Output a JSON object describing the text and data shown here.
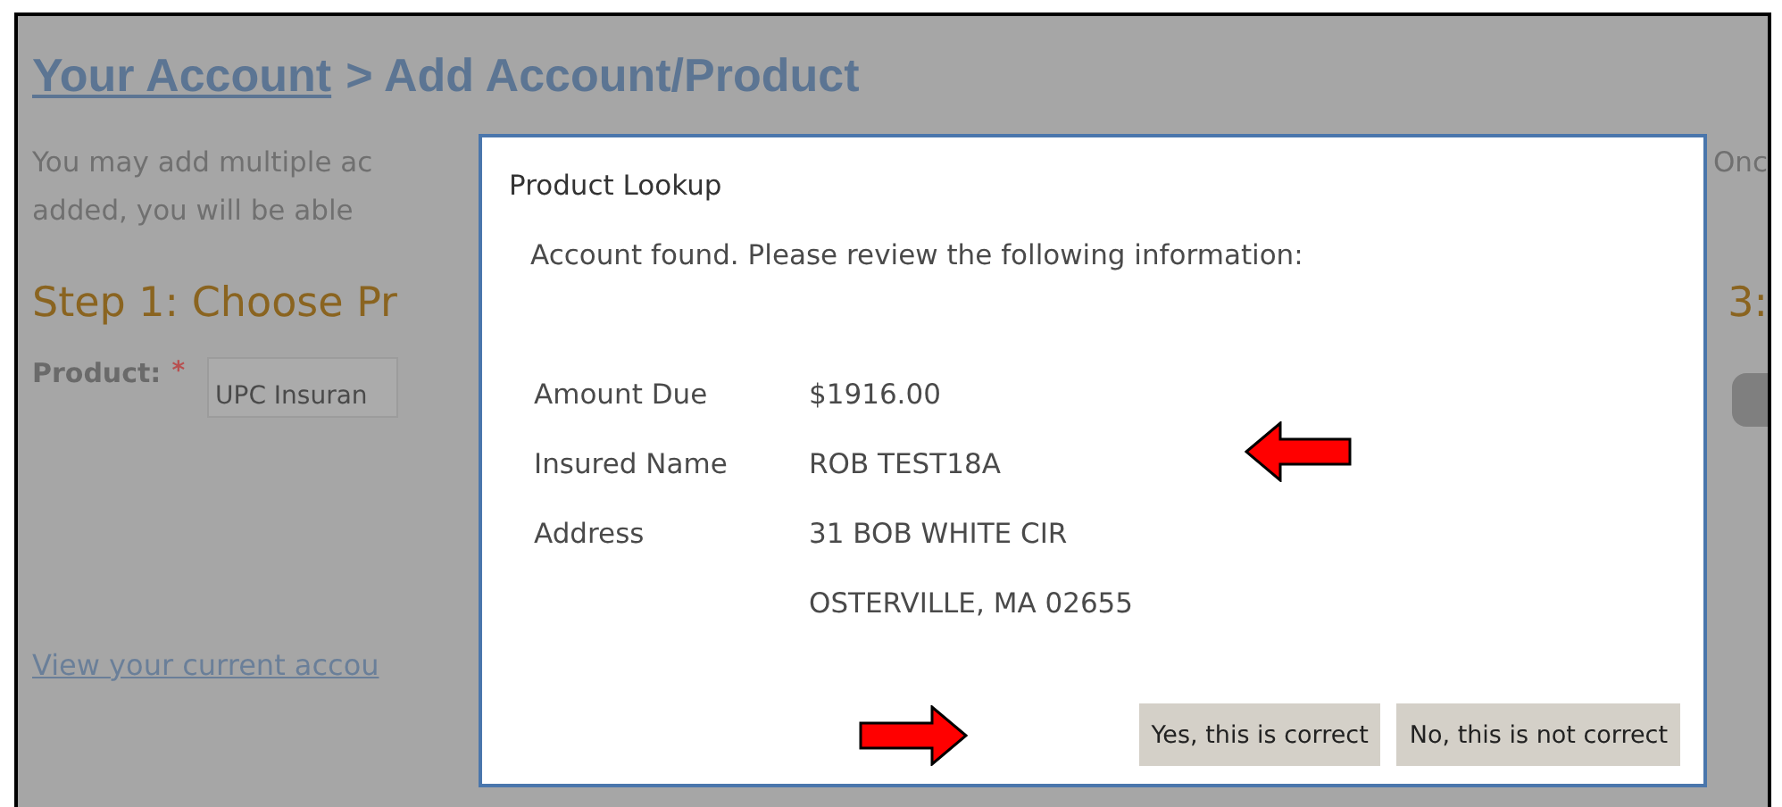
{
  "page": {
    "breadcrumb": {
      "link": "Your Account",
      "current": "> Add Account/Product"
    },
    "intro_lines": [
      "You may add multiple ac",
      "added, you will be able"
    ],
    "intro_right": "Onc",
    "step_heading": "Step 1: Choose Pr",
    "step_right": "3:",
    "product": {
      "label": "Product:",
      "required_mark": "*",
      "value": "UPC Insuran"
    },
    "footer_link": "View your current accou"
  },
  "dialog": {
    "title": "Product Lookup",
    "message": "Account found. Please review the following information:",
    "details": [
      {
        "label": "Amount Due",
        "value": "$1916.00"
      },
      {
        "label": "Insured Name",
        "value": "ROB TEST18A"
      },
      {
        "label": "Address",
        "value": "31 BOB WHITE CIR"
      },
      {
        "value": "OSTERVILLE, MA 02655"
      }
    ],
    "buttons": [
      "Yes, this is correct",
      "No, this is not correct"
    ]
  }
}
